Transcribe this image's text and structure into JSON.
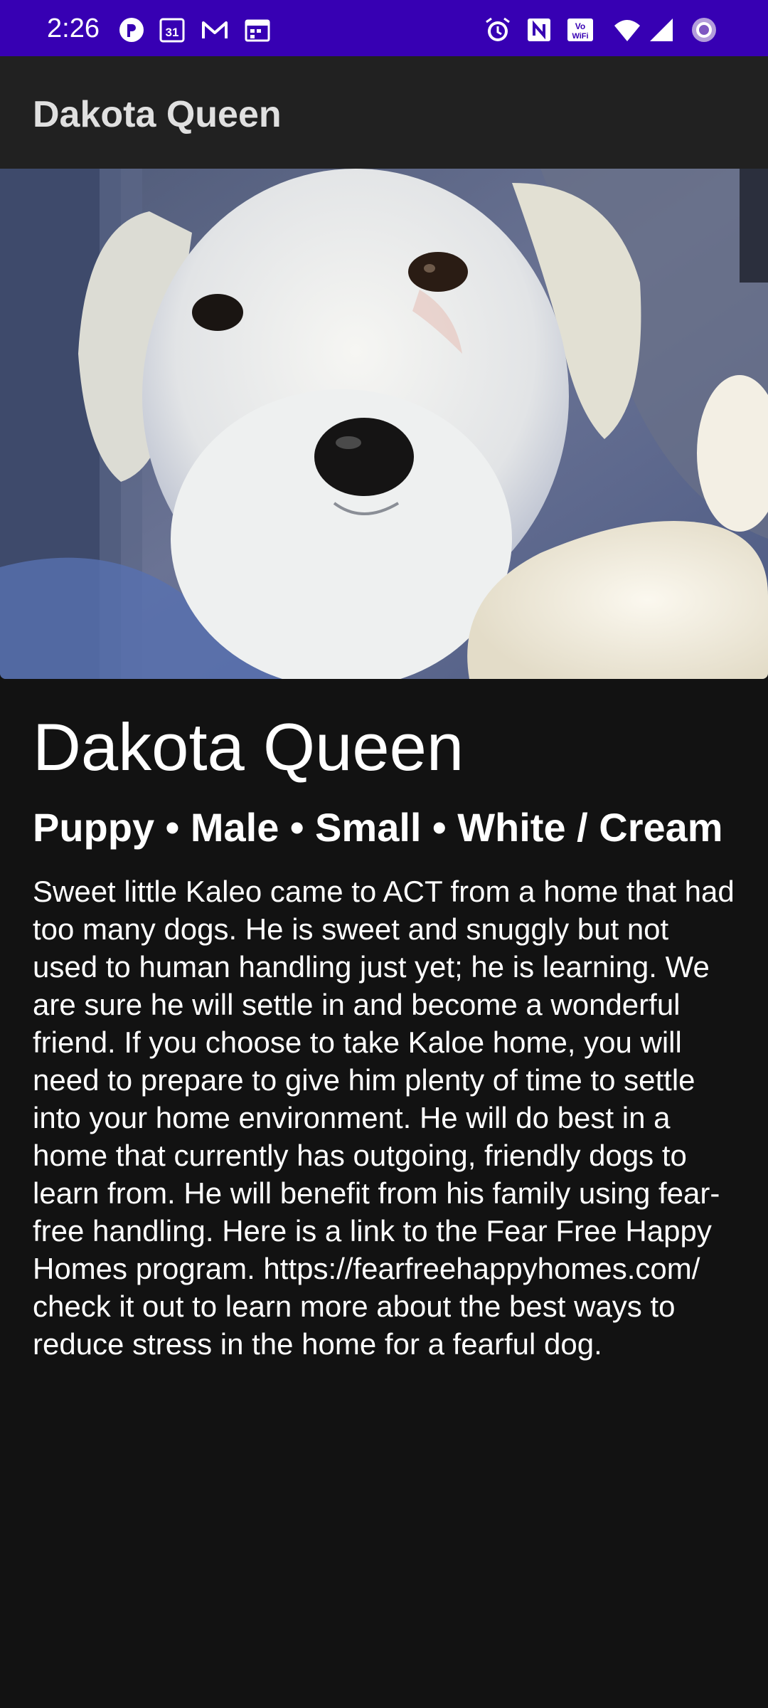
{
  "status_bar": {
    "time": "2:26",
    "left_icons": [
      "fitness-icon",
      "calendar-31-icon",
      "gmail-icon",
      "calendar-icon"
    ],
    "right_icons": [
      "alarm-icon",
      "nfc-icon",
      "vowifi-icon",
      "wifi-icon",
      "signal-icon",
      "record-icon"
    ],
    "calendar_day": "31",
    "background_color": "#3700b3"
  },
  "app_bar": {
    "title": "Dakota Queen",
    "background_color": "#212121"
  },
  "hero_image": {
    "subject": "white puppy photo"
  },
  "pet": {
    "name": "Dakota Queen",
    "attributes": "Puppy • Male • Small • White / Cream",
    "description": "Sweet little Kaleo came to ACT from a home that had too many dogs. He is sweet and snuggly but not used to human handling just yet; he is learning. We are sure he will settle in and become a wonderful friend. If you choose to take Kaloe home, you will need to prepare to give him plenty of time to settle into your home environment. He will do best in a home that currently has outgoing, friendly dogs to learn from. He will benefit from his family using fear-free handling. Here is a link to the Fear Free Happy Homes program. https://fearfreehappyhomes.com/ check it out to learn more about the best ways to reduce stress in the home for a fearful dog."
  }
}
